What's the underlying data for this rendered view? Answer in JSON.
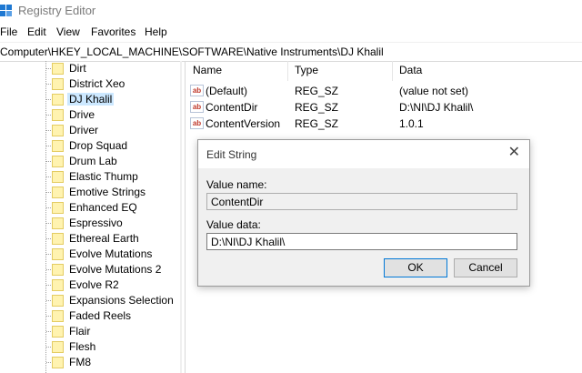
{
  "window": {
    "title": "Registry Editor",
    "icon": "registry-editor-icon"
  },
  "menu": [
    "File",
    "Edit",
    "View",
    "Favorites",
    "Help"
  ],
  "address": "Computer\\HKEY_LOCAL_MACHINE\\SOFTWARE\\Native Instruments\\DJ Khalil",
  "tree": {
    "selected": "DJ Khalil",
    "items": [
      "Dirt",
      "District Xeo",
      "DJ Khalil",
      "Drive",
      "Driver",
      "Drop Squad",
      "Drum Lab",
      "Elastic Thump",
      "Emotive Strings",
      "Enhanced EQ",
      "Espressivo",
      "Ethereal Earth",
      "Evolve Mutations",
      "Evolve Mutations 2",
      "Evolve R2",
      "Expansions Selection",
      "Faded Reels",
      "Flair",
      "Flesh",
      "FM8"
    ]
  },
  "list": {
    "columns": {
      "name": "Name",
      "type": "Type",
      "data": "Data"
    },
    "rows": [
      {
        "name": "(Default)",
        "type": "REG_SZ",
        "data": "(value not set)",
        "icon": "ab-string-icon"
      },
      {
        "name": "ContentDir",
        "type": "REG_SZ",
        "data": "D:\\NI\\DJ Khalil\\",
        "icon": "ab-string-icon"
      },
      {
        "name": "ContentVersion",
        "type": "REG_SZ",
        "data": "1.0.1",
        "icon": "ab-string-icon"
      }
    ]
  },
  "dialog": {
    "title": "Edit String",
    "close_glyph": "✕",
    "value_name_label": "Value name:",
    "value_name": "ContentDir",
    "value_data_label": "Value data:",
    "value_data": "D:\\NI\\DJ Khalil\\",
    "ok_label": "OK",
    "cancel_label": "Cancel"
  },
  "colors": {
    "selection": "#cce8ff",
    "accent": "#0078d7",
    "folder": "#fff3b0"
  }
}
